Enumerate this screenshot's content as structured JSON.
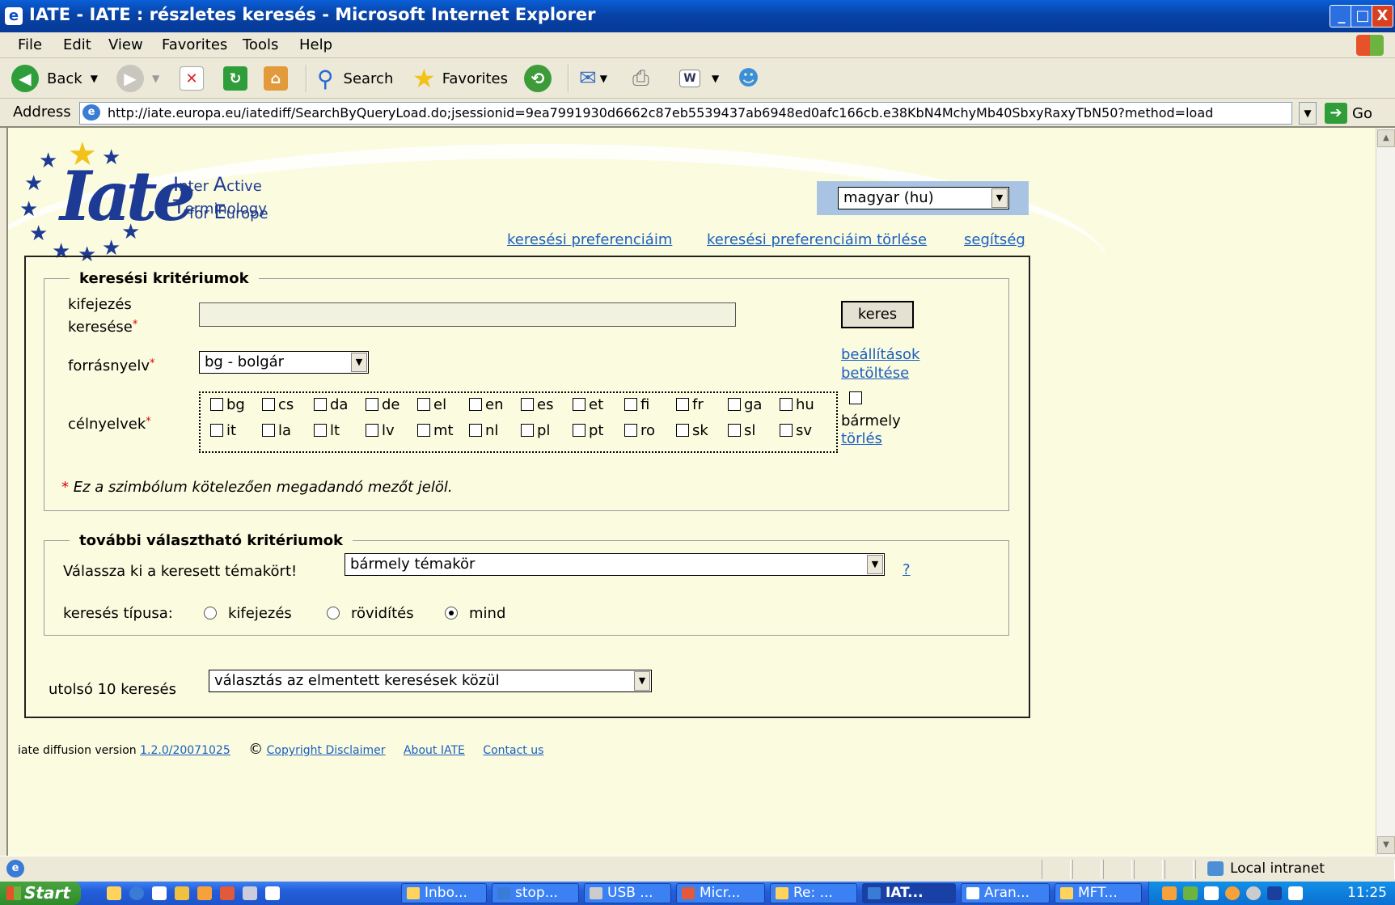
{
  "window": {
    "title": "IATE - IATE : részletes keresés - Microsoft Internet Explorer",
    "controls": [
      "_",
      "□",
      "X"
    ]
  },
  "menubar": {
    "items": [
      "File",
      "Edit",
      "View",
      "Favorites",
      "Tools",
      "Help"
    ]
  },
  "toolbar": {
    "back": "Back",
    "search": "Search",
    "favorites": "Favorites"
  },
  "address": {
    "label": "Address",
    "url": "http://iate.europa.eu/iatediff/SearchByQueryLoad.do;jsessionid=9ea7991930d6662c87eb5539437ab6948ed0afc166cb.e38KbN4MchyMb40SbxyRaxyTbN50?method=load",
    "go": "Go"
  },
  "brand": {
    "logo_text": "Iate",
    "tagline_line1": [
      {
        "cap": "I",
        "rest": "nter "
      },
      {
        "cap": "A",
        "rest": "ctive "
      },
      {
        "cap": "T",
        "rest": "erminology"
      }
    ],
    "tagline_line2": [
      {
        "cap": "",
        "rest": "for "
      },
      {
        "cap": "E",
        "rest": "urope"
      }
    ]
  },
  "language_select": {
    "value": "magyar (hu)"
  },
  "top_links": {
    "prefs": "keresési preferenciáim",
    "clear_prefs": "keresési preferenciáim törlése",
    "help": "segítség"
  },
  "criteria": {
    "legend": "keresési kritériumok",
    "term_label_1": "kifejezés",
    "term_label_2": "keresése",
    "term_value": "",
    "search_button": "keres",
    "source_label": "forrásnyelv",
    "source_value": "bg - bolgár",
    "load_settings_1": "beállítások",
    "load_settings_2": "betöltése",
    "target_label": "célnyelvek",
    "target_row1": [
      "bg",
      "cs",
      "da",
      "de",
      "el",
      "en",
      "es",
      "et",
      "fi",
      "fr",
      "ga",
      "hu"
    ],
    "target_row2": [
      "it",
      "la",
      "lt",
      "lv",
      "mt",
      "nl",
      "pl",
      "pt",
      "ro",
      "sk",
      "sl",
      "sv"
    ],
    "any": "bármely",
    "clear": "törlés",
    "required_star": "*",
    "required_note": "Ez a szimbólum kötelezően megadandó mezőt jelöl."
  },
  "optional": {
    "legend": "további választható kritériumok",
    "domain_label": "Válassza ki a keresett témakört!",
    "domain_value": "bármely témakör",
    "domain_help": "?",
    "type_label": "keresés típusa:",
    "type_options": [
      "kifejezés",
      "rövidítés",
      "mind"
    ],
    "type_selected": "mind"
  },
  "recent": {
    "label": "utolsó 10 keresés",
    "value": "választás az elmentett keresések közül"
  },
  "footer": {
    "version_prefix": "iate diffusion version",
    "version": "1.2.0/20071025",
    "copyright_symbol": "©",
    "copyright": "Copyright Disclaimer",
    "about": "About IATE",
    "contact": "Contact us"
  },
  "statusbar": {
    "zone": "Local intranet"
  },
  "taskbar": {
    "start": "Start",
    "tasks": [
      "Inbo...",
      "stop...",
      "USB ...",
      "Micr...",
      "Re: ...",
      "IAT...",
      "Aran...",
      "MFT..."
    ],
    "active_task": "IAT...",
    "clock": "11:25"
  }
}
